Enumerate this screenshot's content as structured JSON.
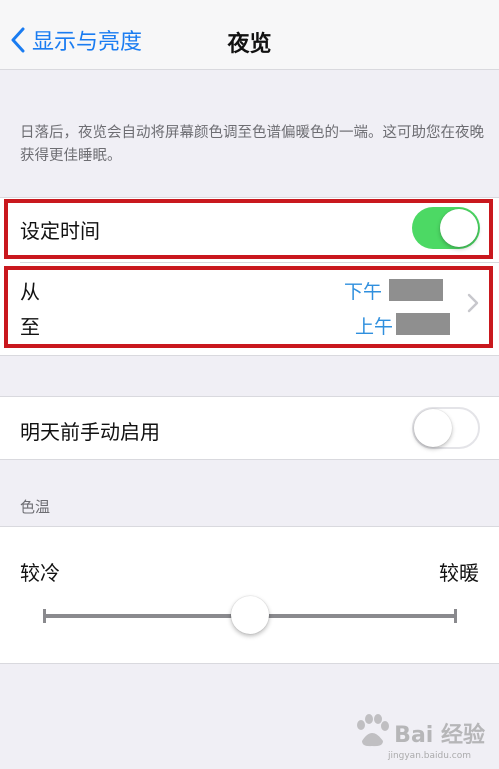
{
  "nav": {
    "back_label": "显示与亮度",
    "title": "夜览"
  },
  "description": "日落后，夜览会自动将屏幕颜色调至色谱偏暖色的一端。这可助您在夜晚获得更佳睡眠。",
  "scheduled": {
    "label": "设定时间",
    "enabled": true
  },
  "schedule_times": {
    "from_label": "从",
    "from_value": "下午",
    "to_label": "至",
    "to_value": "上午"
  },
  "manual": {
    "label": "明天前手动启用",
    "enabled": false
  },
  "color_temp": {
    "section_label": "色温",
    "cooler_label": "较冷",
    "warmer_label": "较暖",
    "value_fraction": 0.5
  },
  "watermark": {
    "text": "Bai 经验",
    "url": "jingyan.baidu.com"
  },
  "colors": {
    "accent": "#1a7cf1",
    "toggle_on": "#4cd964",
    "highlight": "#c9181e",
    "time_value": "#2f8fde"
  },
  "icons": {
    "back": "chevron-left-icon",
    "disclosure": "chevron-right-icon"
  }
}
